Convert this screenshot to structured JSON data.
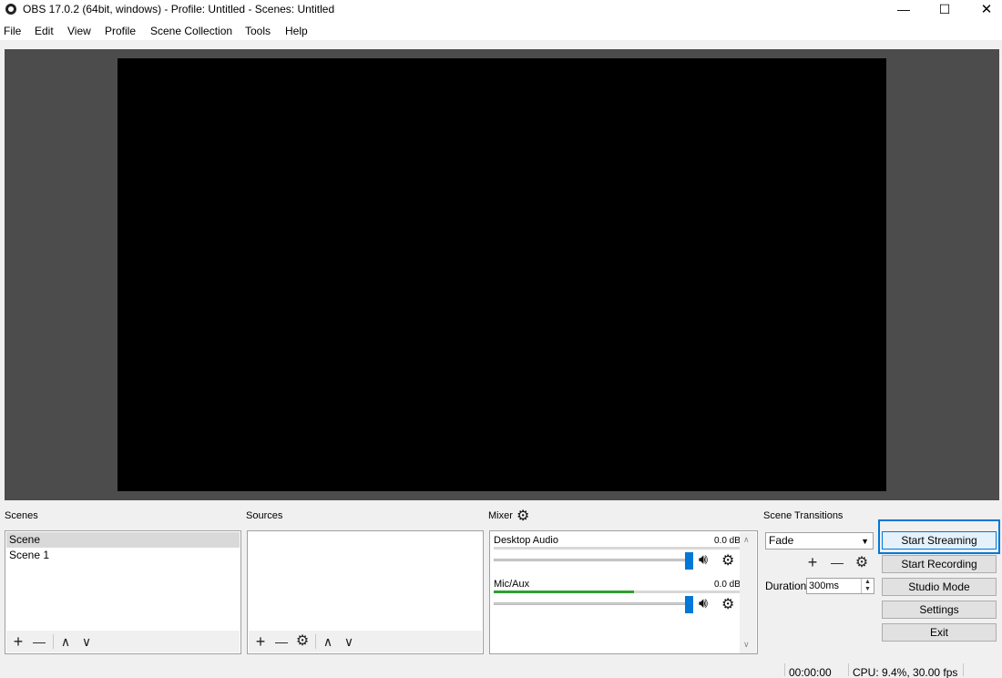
{
  "window": {
    "title": "OBS 17.0.2 (64bit, windows) - Profile: Untitled - Scenes: Untitled",
    "controls": {
      "minimize": "—",
      "maximize": "☐",
      "close": "✕"
    }
  },
  "menu": {
    "items": [
      "File",
      "Edit",
      "View",
      "Profile",
      "Scene Collection",
      "Tools",
      "Help"
    ]
  },
  "scenes": {
    "title": "Scenes",
    "items": [
      "Scene",
      "Scene 1"
    ],
    "selected_index": 0,
    "toolbar": {
      "add": "+",
      "remove": "—",
      "up": "∧",
      "down": "∨"
    }
  },
  "sources": {
    "title": "Sources",
    "items": [],
    "toolbar": {
      "add": "+",
      "remove": "—",
      "settings": "⚙",
      "up": "∧",
      "down": "∨"
    }
  },
  "mixer": {
    "title": "Mixer",
    "channels": [
      {
        "name": "Desktop Audio",
        "db": "0.0 dB",
        "meter_level": 0.0,
        "volume": 1.0
      },
      {
        "name": "Mic/Aux",
        "db": "0.0 dB",
        "meter_level": 0.57,
        "volume": 1.0
      }
    ]
  },
  "transitions": {
    "title": "Scene Transitions",
    "selected": "Fade",
    "duration_label": "Duration",
    "duration_value": "300ms",
    "toolbar": {
      "add": "+",
      "remove": "—",
      "settings": "⚙"
    }
  },
  "controls": {
    "start_streaming": "Start Streaming",
    "start_recording": "Start Recording",
    "studio_mode": "Studio Mode",
    "settings": "Settings",
    "exit": "Exit"
  },
  "status": {
    "time": "00:00:00",
    "cpu": "CPU: 9.4%, 30.00 fps"
  },
  "colors": {
    "accent": "#0078d7",
    "meter_green": "#2fa02f",
    "preview_bg": "#4c4c4c",
    "canvas": "#000000"
  }
}
